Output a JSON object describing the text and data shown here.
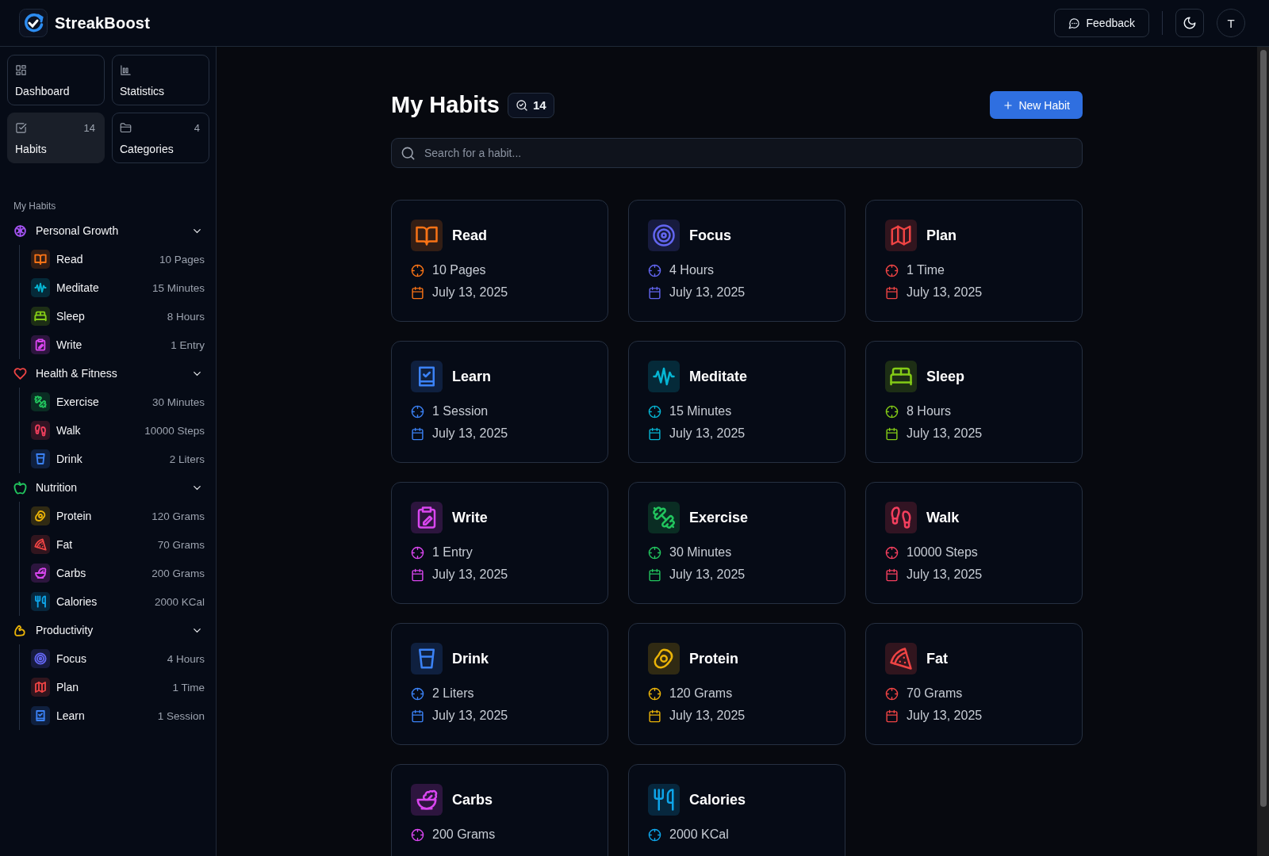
{
  "app": {
    "name": "StreakBoost"
  },
  "header": {
    "feedback": "Feedback",
    "avatar": "T"
  },
  "nav": [
    {
      "label": "Dashboard",
      "kind": "grid",
      "selected": false
    },
    {
      "label": "Statistics",
      "kind": "chart",
      "selected": false
    },
    {
      "label": "Habits",
      "kind": "check",
      "count": "14",
      "selected": true
    },
    {
      "label": "Categories",
      "kind": "folder",
      "count": "4",
      "selected": false
    }
  ],
  "sidebar": {
    "heading": "My Habits",
    "groups": [
      {
        "name": "Personal Growth",
        "kind": "brain",
        "color": "#a855f7",
        "expanded": true,
        "children": [
          {
            "name": "Read",
            "goal": "10 Pages",
            "kind": "book",
            "color": "#f97316"
          },
          {
            "name": "Meditate",
            "goal": "15 Minutes",
            "kind": "wave",
            "color": "#06b6d4"
          },
          {
            "name": "Sleep",
            "goal": "8 Hours",
            "kind": "bed",
            "color": "#84cc16"
          },
          {
            "name": "Write",
            "goal": "1 Entry",
            "kind": "clipboard",
            "color": "#d946ef"
          }
        ]
      },
      {
        "name": "Health & Fitness",
        "kind": "heart",
        "color": "#ef4444",
        "expanded": true,
        "children": [
          {
            "name": "Exercise",
            "goal": "30 Minutes",
            "kind": "dumbbell",
            "color": "#22c55e"
          },
          {
            "name": "Walk",
            "goal": "10000 Steps",
            "kind": "footprints",
            "color": "#f43f5e"
          },
          {
            "name": "Drink",
            "goal": "2 Liters",
            "kind": "cup",
            "color": "#3b82f6"
          }
        ]
      },
      {
        "name": "Nutrition",
        "kind": "apple",
        "color": "#22c55e",
        "expanded": true,
        "children": [
          {
            "name": "Protein",
            "goal": "120 Grams",
            "kind": "egg",
            "color": "#eab308"
          },
          {
            "name": "Fat",
            "goal": "70 Grams",
            "kind": "pizza",
            "color": "#ef4444"
          },
          {
            "name": "Carbs",
            "goal": "200 Grams",
            "kind": "salad",
            "color": "#d946ef"
          },
          {
            "name": "Calories",
            "goal": "2000 KCal",
            "kind": "utensils",
            "color": "#0ea5e9"
          }
        ]
      },
      {
        "name": "Productivity",
        "kind": "biceps",
        "color": "#eab308",
        "expanded": true,
        "children": [
          {
            "name": "Focus",
            "goal": "4 Hours",
            "kind": "target",
            "color": "#6366f1"
          },
          {
            "name": "Plan",
            "goal": "1 Time",
            "kind": "map",
            "color": "#ef4444"
          },
          {
            "name": "Learn",
            "goal": "1 Session",
            "kind": "notebook",
            "color": "#3b82f6"
          }
        ]
      }
    ]
  },
  "page": {
    "title": "My Habits",
    "count": "14",
    "new_button": "New Habit",
    "search": {
      "placeholder": "Search for a habit..."
    }
  },
  "habits": [
    {
      "name": "Read",
      "goal": "10 Pages",
      "date": "July 13, 2025",
      "kind": "book",
      "color": "#f97316"
    },
    {
      "name": "Focus",
      "goal": "4 Hours",
      "date": "July 13, 2025",
      "kind": "target",
      "color": "#6366f1"
    },
    {
      "name": "Plan",
      "goal": "1 Time",
      "date": "July 13, 2025",
      "kind": "map",
      "color": "#ef4444"
    },
    {
      "name": "Learn",
      "goal": "1 Session",
      "date": "July 13, 2025",
      "kind": "notebook",
      "color": "#3b82f6"
    },
    {
      "name": "Meditate",
      "goal": "15 Minutes",
      "date": "July 13, 2025",
      "kind": "wave",
      "color": "#06b6d4"
    },
    {
      "name": "Sleep",
      "goal": "8 Hours",
      "date": "July 13, 2025",
      "kind": "bed",
      "color": "#84cc16"
    },
    {
      "name": "Write",
      "goal": "1 Entry",
      "date": "July 13, 2025",
      "kind": "clipboard",
      "color": "#d946ef"
    },
    {
      "name": "Exercise",
      "goal": "30 Minutes",
      "date": "July 13, 2025",
      "kind": "dumbbell",
      "color": "#22c55e"
    },
    {
      "name": "Walk",
      "goal": "10000 Steps",
      "date": "July 13, 2025",
      "kind": "footprints",
      "color": "#f43f5e"
    },
    {
      "name": "Drink",
      "goal": "2 Liters",
      "date": "July 13, 2025",
      "kind": "cup",
      "color": "#3b82f6"
    },
    {
      "name": "Protein",
      "goal": "120 Grams",
      "date": "July 13, 2025",
      "kind": "egg",
      "color": "#eab308"
    },
    {
      "name": "Fat",
      "goal": "70 Grams",
      "date": "July 13, 2025",
      "kind": "pizza",
      "color": "#ef4444"
    },
    {
      "name": "Carbs",
      "goal": "200 Grams",
      "kind": "salad",
      "color": "#d946ef"
    },
    {
      "name": "Calories",
      "goal": "2000 KCal",
      "kind": "utensils",
      "color": "#0ea5e9"
    }
  ]
}
